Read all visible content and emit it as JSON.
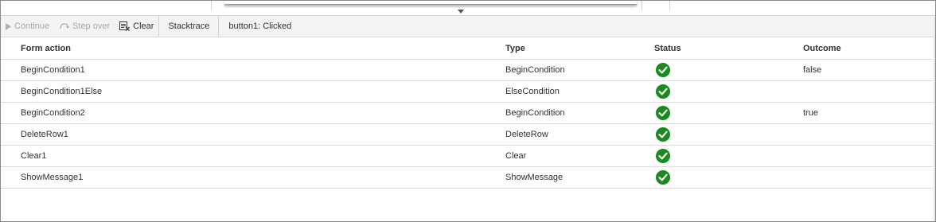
{
  "toolbar": {
    "continue_label": "Continue",
    "step_over_label": "Step over",
    "clear_label": "Clear",
    "stacktrace_label": "Stacktrace",
    "status_text": "button1: Clicked"
  },
  "table": {
    "columns": {
      "form_action": "Form action",
      "type": "Type",
      "status": "Status",
      "outcome": "Outcome"
    },
    "rows": [
      {
        "form_action": "BeginCondition1",
        "type": "BeginCondition",
        "status": "success",
        "outcome": "false"
      },
      {
        "form_action": "BeginCondition1Else",
        "type": "ElseCondition",
        "status": "success",
        "outcome": ""
      },
      {
        "form_action": "BeginCondition2",
        "type": "BeginCondition",
        "status": "success",
        "outcome": "true"
      },
      {
        "form_action": "DeleteRow1",
        "type": "DeleteRow",
        "status": "success",
        "outcome": ""
      },
      {
        "form_action": "Clear1",
        "type": "Clear",
        "status": "success",
        "outcome": ""
      },
      {
        "form_action": "ShowMessage1",
        "type": "ShowMessage",
        "status": "success",
        "outcome": ""
      }
    ]
  },
  "colors": {
    "success": "#1a8a1f",
    "disabled_text": "#a8a8a8",
    "toolbar_bg": "#f3f3f3"
  },
  "icons": {
    "continue": "play-icon",
    "step_over": "step-over-icon",
    "clear": "clear-list-icon",
    "status": "check-circle-icon",
    "splitter": "chevron-down-icon"
  }
}
